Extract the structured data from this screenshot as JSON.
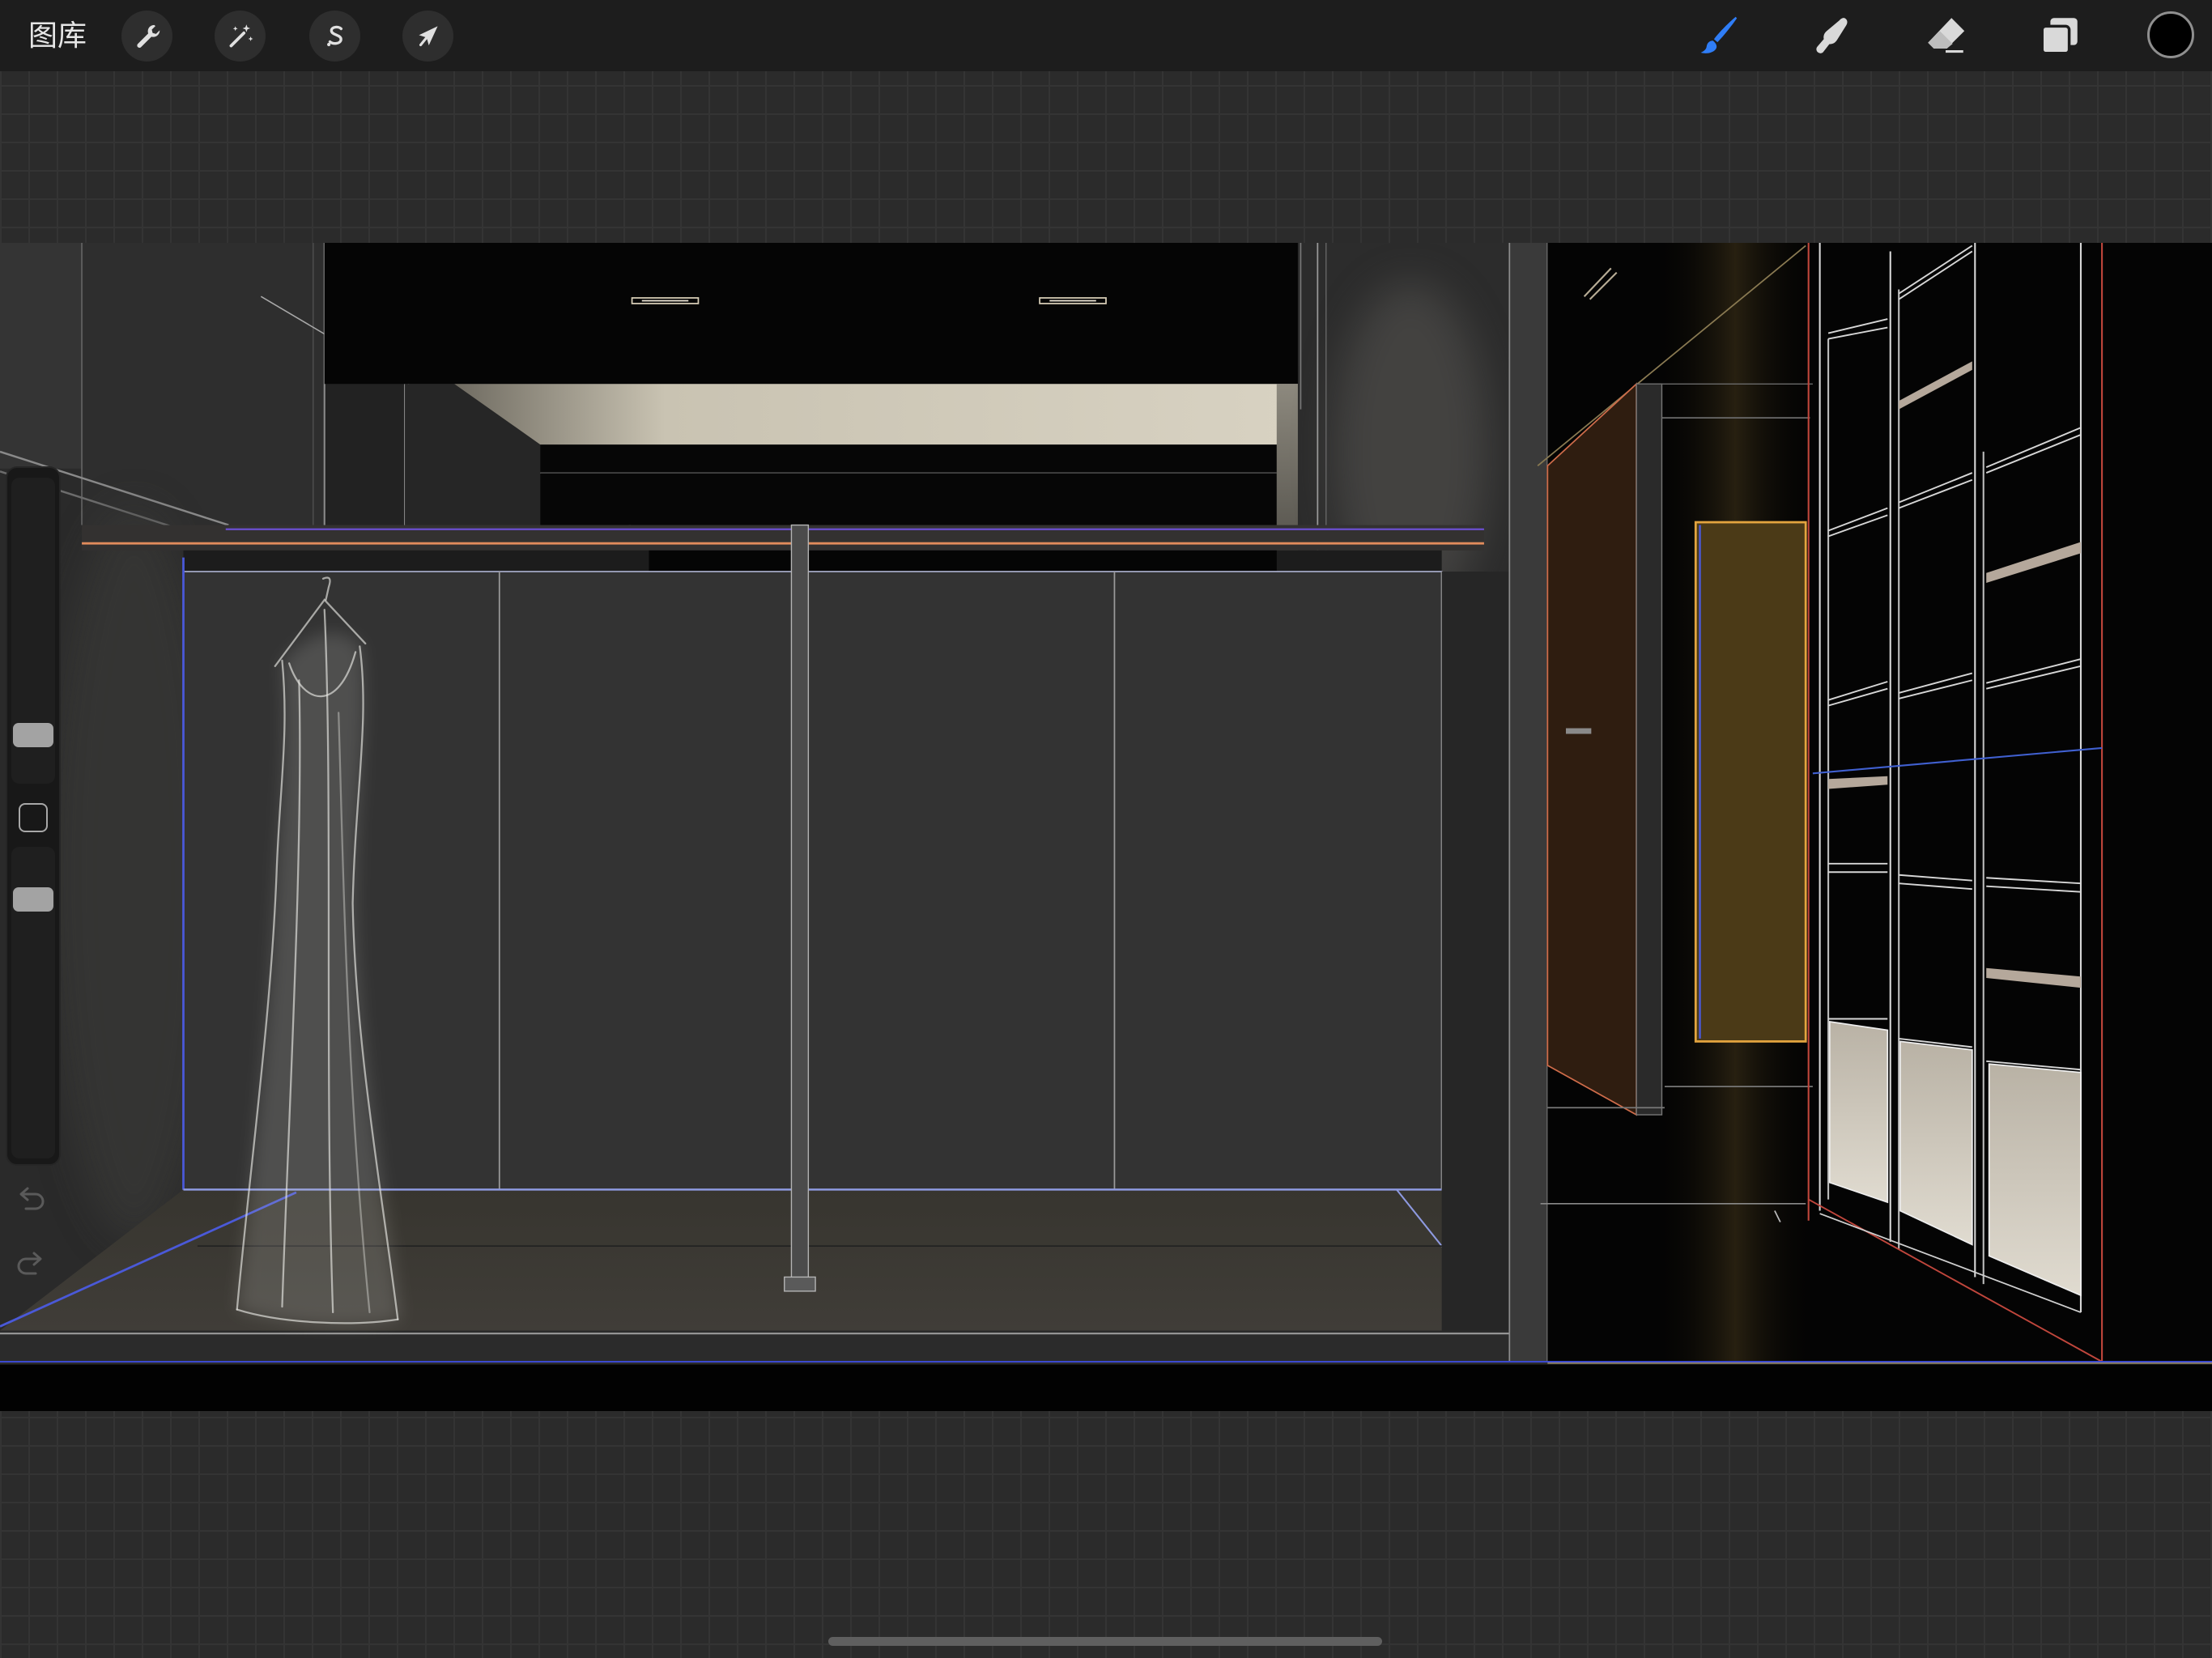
{
  "toolbar": {
    "gallery_label": "图库",
    "left_actions": [
      {
        "icon": "wrench-icon"
      },
      {
        "icon": "magic-wand-icon"
      },
      {
        "icon": "selection-icon"
      },
      {
        "icon": "transform-arrow-icon"
      }
    ],
    "right_tools": [
      {
        "icon": "brush-icon",
        "active": true
      },
      {
        "icon": "smudge-icon",
        "active": false
      },
      {
        "icon": "eraser-icon",
        "active": false
      },
      {
        "icon": "layers-icon",
        "active": false
      },
      {
        "icon": "color-swatch-icon",
        "active": false
      }
    ],
    "current_color": "#000000"
  },
  "sidebar": {
    "brush_size": 0.16,
    "opacity": 0.83,
    "modify_icon": "square-icon",
    "undo_icon": "undo-icon",
    "redo_icon": "redo-icon"
  },
  "colors": {
    "accent": "#2f7df6",
    "toolbar_background": "#1d1d1d",
    "canvas_surround": "#2b2b2b",
    "inactive_icon": "#d9d9d9"
  }
}
